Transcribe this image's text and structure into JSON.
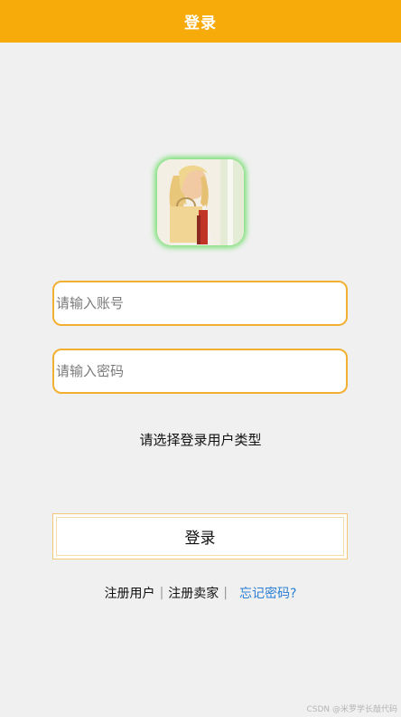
{
  "header": {
    "title": "登录"
  },
  "avatar": {
    "icon": "shopping-woman-photo"
  },
  "form": {
    "account_placeholder": "请输入账号",
    "password_placeholder": "请输入密码",
    "user_type_label": "请选择登录用户类型",
    "login_label": "登录"
  },
  "links": {
    "register_user": "注册用户",
    "separator": "|",
    "register_seller": "注册卖家",
    "forgot_password": "忘记密码?"
  },
  "watermark": "CSDN @米罗学长敲代码",
  "colors": {
    "header": "#f7ab0b",
    "input_border": "#f2b032",
    "link_blue": "#2a7fd4",
    "avatar_glow": "#7ee07a"
  }
}
